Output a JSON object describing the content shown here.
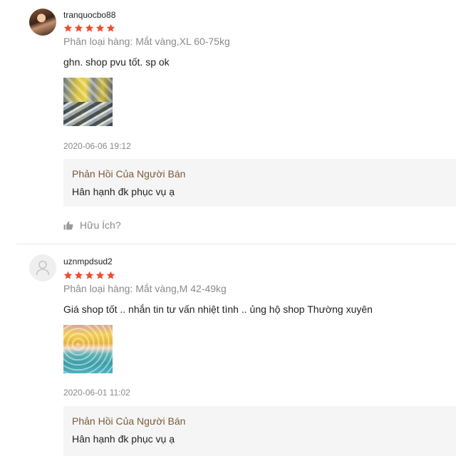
{
  "colors": {
    "star": "#ee4d2d",
    "reply_title": "#7a5a3a",
    "muted": "#8a8a8a",
    "reply_bg": "#f5f5f5"
  },
  "reviews": [
    {
      "username": "tranquocbo88",
      "rating": 5,
      "variant": "Phân loại hàng: Mắt vàng,XL 60-75kg",
      "text": "ghn. shop pvu tốt. sp ok",
      "date": "2020-06-06 19:12",
      "reply": {
        "title": "Phản Hồi Của Người Bán",
        "body": "Hân hạnh đk phục vụ ạ"
      },
      "helpful_label": "Hữu Ích?"
    },
    {
      "username": "uznmpdsud2",
      "rating": 5,
      "variant": "Phân loại hàng: Mắt vàng,M 42-49kg",
      "text": "Giá shop tốt .. nhắn tin tư vấn nhiệt tình .. ủng hộ shop Thường xuyên",
      "date": "2020-06-01 11:02",
      "reply": {
        "title": "Phản Hồi Của Người Bán",
        "body": "Hân hạnh đk phục vụ ạ"
      }
    }
  ]
}
